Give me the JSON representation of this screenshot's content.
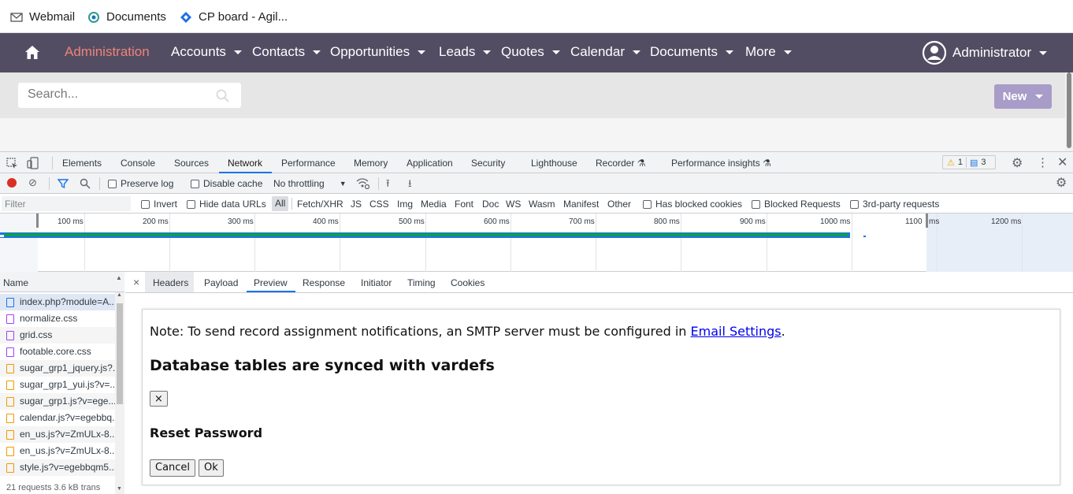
{
  "bookmarks": [
    {
      "label": "Webmail",
      "icon": "mail-icon"
    },
    {
      "label": "Documents",
      "icon": "documents-icon"
    },
    {
      "label": "CP board - Agil...",
      "icon": "jira-icon"
    }
  ],
  "nav": {
    "home_icon": "home-icon",
    "items": [
      "Administration",
      "Accounts",
      "Contacts",
      "Opportunities",
      "Leads",
      "Quotes",
      "Calendar",
      "Documents",
      "More"
    ],
    "user": "Administrator",
    "active_color": "#f08377",
    "bg_color": "#534d64"
  },
  "search": {
    "placeholder": "Search..."
  },
  "new_button": "New",
  "devtools": {
    "tabs": [
      "Elements",
      "Console",
      "Sources",
      "Network",
      "Performance",
      "Memory",
      "Application",
      "Security",
      "Lighthouse",
      "Recorder",
      "Performance insights"
    ],
    "active_tab": "Network",
    "warnings": "1",
    "messages": "3",
    "toolbar": {
      "preserve_log": "Preserve log",
      "disable_cache": "Disable cache",
      "throttling": "No throttling"
    },
    "filter": {
      "placeholder": "Filter",
      "invert": "Invert",
      "hide_data_urls": "Hide data URLs",
      "types": [
        "All",
        "Fetch/XHR",
        "JS",
        "CSS",
        "Img",
        "Media",
        "Font",
        "Doc",
        "WS",
        "Wasm",
        "Manifest",
        "Other"
      ],
      "has_blocked_cookies": "Has blocked cookies",
      "blocked_requests": "Blocked Requests",
      "third_party": "3rd-party requests"
    },
    "timeline_ticks": [
      "100 ms",
      "200 ms",
      "300 ms",
      "400 ms",
      "500 ms",
      "600 ms",
      "700 ms",
      "800 ms",
      "900 ms",
      "1000 ms",
      "1100",
      "ms",
      "1200 ms"
    ],
    "request_list": {
      "header": "Name",
      "items": [
        {
          "name": "index.php?module=A...",
          "type": "doc"
        },
        {
          "name": "normalize.css",
          "type": "css"
        },
        {
          "name": "grid.css",
          "type": "css"
        },
        {
          "name": "footable.core.css",
          "type": "css"
        },
        {
          "name": "sugar_grp1_jquery.js?...",
          "type": "js"
        },
        {
          "name": "sugar_grp1_yui.js?v=...",
          "type": "js"
        },
        {
          "name": "sugar_grp1.js?v=ege...",
          "type": "js"
        },
        {
          "name": "calendar.js?v=egebbq...",
          "type": "js"
        },
        {
          "name": "en_us.js?v=ZmULx-8...",
          "type": "js"
        },
        {
          "name": "en_us.js?v=ZmULx-8...",
          "type": "js"
        },
        {
          "name": "style.js?v=egebbqm5...",
          "type": "js"
        }
      ],
      "footer": "21 requests   3.6 kB trans"
    },
    "detail_tabs": [
      "Headers",
      "Payload",
      "Preview",
      "Response",
      "Initiator",
      "Timing",
      "Cookies"
    ],
    "detail_active": "Preview",
    "preview": {
      "note_prefix": "Note: To send record assignment notifications, an SMTP server must be configured in ",
      "note_link": "Email Settings",
      "note_suffix": ".",
      "synced": "Database tables are synced with vardefs",
      "close_label": "×",
      "reset_password": "Reset Password",
      "cancel": "Cancel",
      "ok": "Ok"
    }
  }
}
